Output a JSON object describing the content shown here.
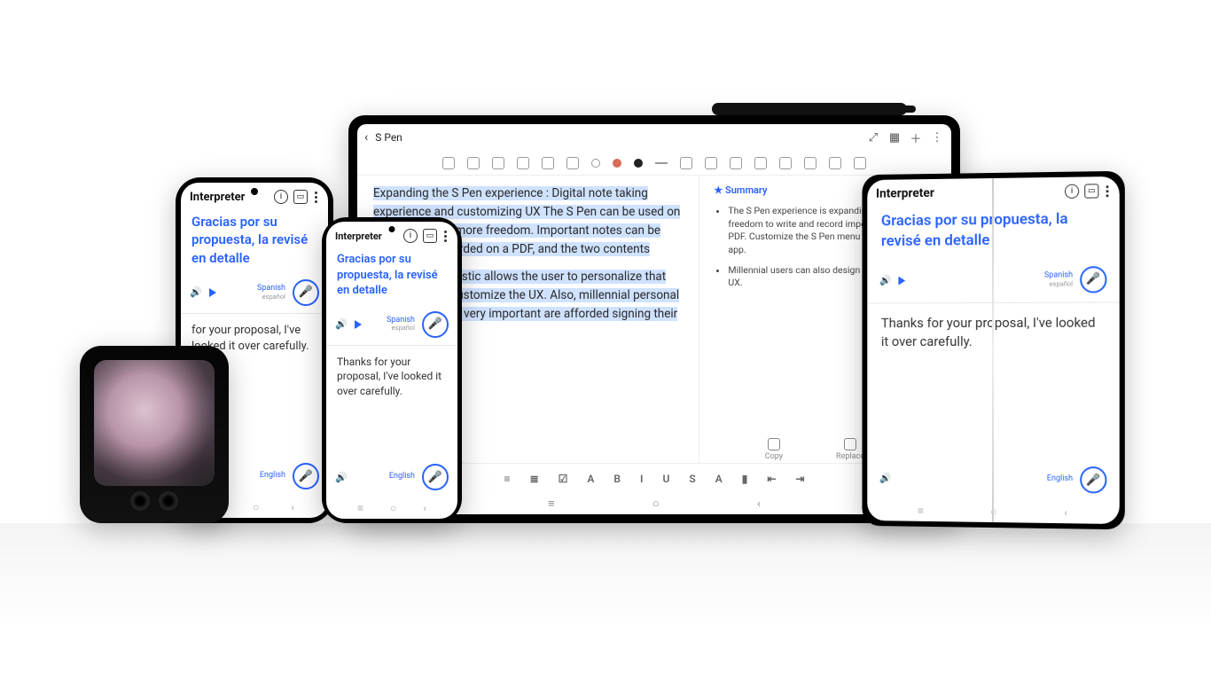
{
  "interpreter": {
    "title": "Interpreter",
    "source_text": "Gracias por su propuesta, la revisé en detalle",
    "target_text_short": "Thanks for your proposal, I've looked it over carefully.",
    "target_text_partial": "for your proposal, I've looked it over carefully.",
    "source_lang": {
      "name": "Spanish",
      "native": "español"
    },
    "target_lang": {
      "name": "English"
    }
  },
  "tablet": {
    "title": "S Pen",
    "paragraph1": "Expanding the S Pen experience : Digital note taking experience and customizing UX The S Pen can be used on Note with even more freedom. Important notes can be written and recorded on a PDF, and the two contents",
    "paragraph2": "app called Pentastic allows the user to personalize that they want and customize the UX. Also, millennial personal expression to be very important are afforded signing their own S Pen UX.",
    "summary_title": "Summary",
    "summary_items": [
      "The S Pen experience is expanding with more freedom to write and record important notes on a PDF. Customize the S Pen menu with the Pentastic app.",
      "Millennial users can also design their own S Pen UX."
    ],
    "actions": {
      "copy": "Copy",
      "replace": "Replace"
    }
  }
}
